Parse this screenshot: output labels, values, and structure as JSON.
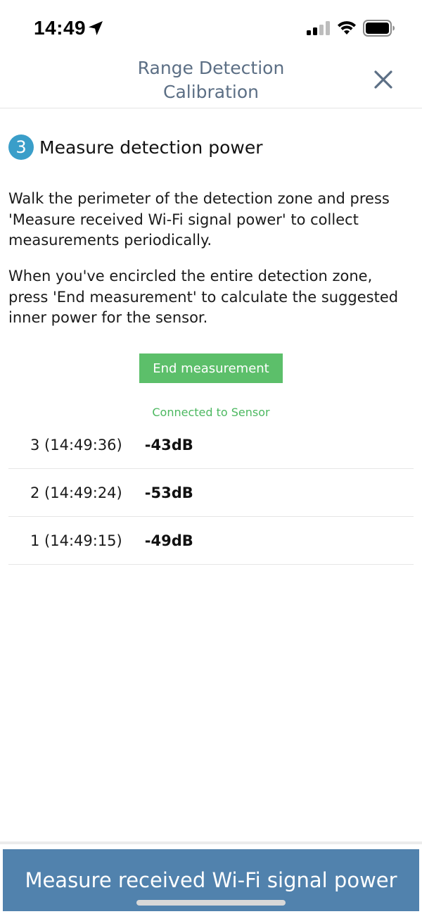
{
  "status_bar": {
    "time": "14:49"
  },
  "header": {
    "title_line1": "Range Detection",
    "title_line2": "Calibration"
  },
  "step": {
    "number": "3",
    "title": "Measure detection power"
  },
  "instructions": {
    "paragraph1": "Walk the perimeter of the detection zone and press 'Measure received Wi-Fi signal power' to collect measurements periodically.",
    "paragraph2": "When you've encircled the entire detection zone, press 'End measurement' to calculate the suggested inner power for the sensor."
  },
  "end_button_label": "End measurement",
  "connection_status": "Connected to Sensor",
  "measurements": [
    {
      "label": "3 (14:49:36)",
      "value": "-43dB"
    },
    {
      "label": "2 (14:49:24)",
      "value": "-53dB"
    },
    {
      "label": "1 (14:49:15)",
      "value": "-49dB"
    }
  ],
  "measure_button_label": "Measure received Wi-Fi signal power",
  "colors": {
    "accent_green": "#5cbf6a",
    "primary_blue": "#5182ad",
    "step_badge": "#3a9ec9",
    "header_text": "#5c6f85"
  }
}
